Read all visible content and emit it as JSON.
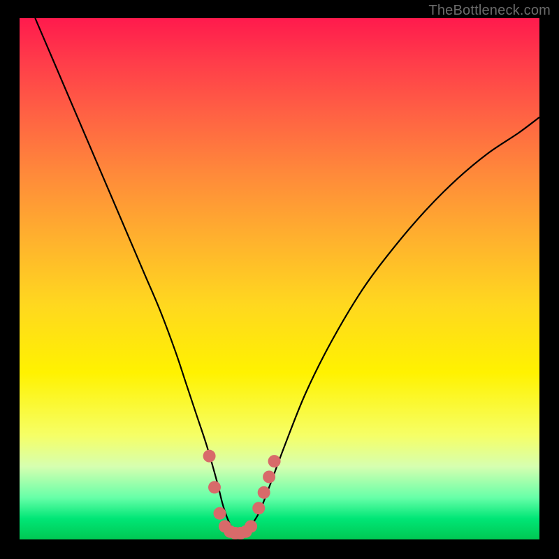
{
  "watermark": "TheBottleneck.com",
  "chart_data": {
    "type": "line",
    "title": "",
    "xlabel": "",
    "ylabel": "",
    "xlim": [
      0,
      100
    ],
    "ylim": [
      0,
      100
    ],
    "series": [
      {
        "name": "bottleneck-curve",
        "x": [
          3,
          6,
          9,
          12,
          15,
          18,
          21,
          24,
          27,
          30,
          32,
          34,
          36,
          38,
          39,
          40,
          41,
          42,
          43,
          44,
          46,
          48,
          51,
          55,
          60,
          66,
          72,
          78,
          84,
          90,
          96,
          100
        ],
        "y": [
          100,
          93,
          86,
          79,
          72,
          65,
          58,
          51,
          44,
          36,
          30,
          24,
          18,
          11,
          7,
          4,
          2,
          1,
          1,
          2,
          5,
          10,
          18,
          28,
          38,
          48,
          56,
          63,
          69,
          74,
          78,
          81
        ]
      }
    ],
    "markers": {
      "name": "marker-dots",
      "color": "#d86a6a",
      "points": [
        {
          "x": 36.5,
          "y": 16
        },
        {
          "x": 37.5,
          "y": 10
        },
        {
          "x": 38.5,
          "y": 5
        },
        {
          "x": 39.5,
          "y": 2.5
        },
        {
          "x": 40.5,
          "y": 1.5
        },
        {
          "x": 41.5,
          "y": 1.2
        },
        {
          "x": 42.5,
          "y": 1.2
        },
        {
          "x": 43.5,
          "y": 1.5
        },
        {
          "x": 44.5,
          "y": 2.5
        },
        {
          "x": 46.0,
          "y": 6
        },
        {
          "x": 47.0,
          "y": 9
        },
        {
          "x": 48.0,
          "y": 12
        },
        {
          "x": 49.0,
          "y": 15
        }
      ]
    }
  }
}
